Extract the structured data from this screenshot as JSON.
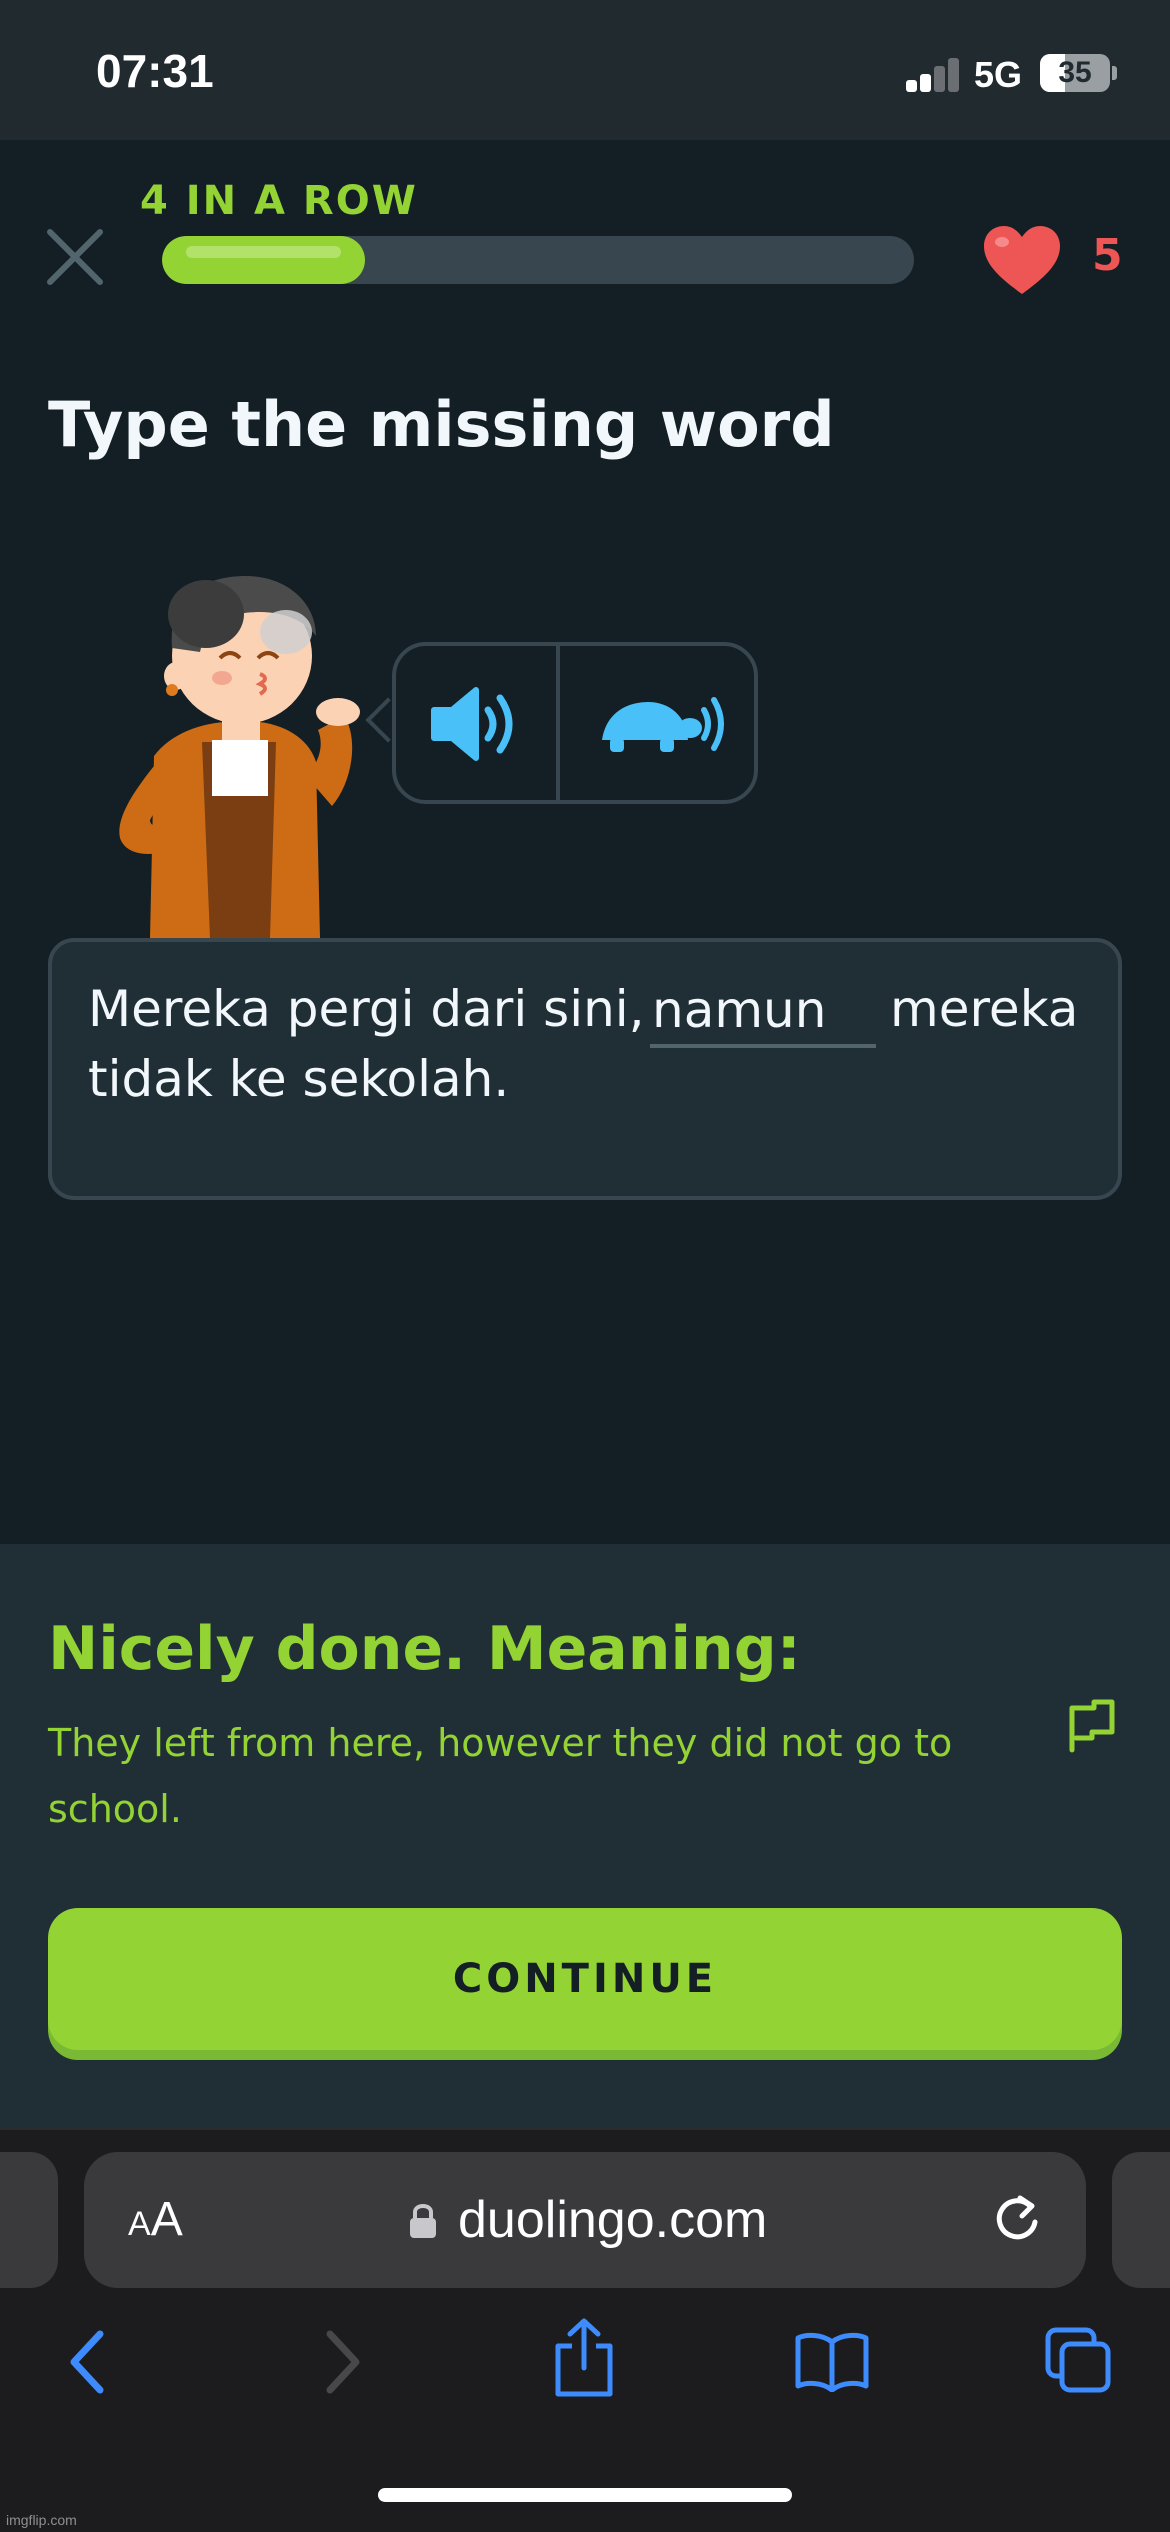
{
  "status_bar": {
    "time": "07:31",
    "network": "5G",
    "battery_level": "35",
    "battery_percent": 35,
    "signal_bars_active": 2,
    "signal_bars_total": 4
  },
  "header": {
    "streak_label": "4 IN A ROW",
    "progress_fraction": 0.27,
    "hearts_count": "5",
    "close_icon": "close-icon",
    "heart_icon": "heart-icon"
  },
  "challenge": {
    "title": "Type the missing word",
    "audio_normal_icon": "speaker-icon",
    "audio_slow_icon": "turtle-speaker-icon",
    "sentence_before": "Mereka pergi dari sini, ",
    "answer_value": "namun",
    "sentence_after": "mereka",
    "sentence_line2": "tidak ke sekolah."
  },
  "feedback": {
    "title": "Nicely done. Meaning:",
    "meaning": "They left from here, however they did not go to school.",
    "report_icon": "flag-icon",
    "continue_label": "CONTINUE"
  },
  "browser": {
    "text_size_label_small": "A",
    "text_size_label_large": "A",
    "url": "duolingo.com",
    "lock_icon": "lock-icon",
    "reload_icon": "reload-icon",
    "nav_icons": [
      "back-icon",
      "forward-icon",
      "share-icon",
      "bookmarks-icon",
      "tabs-icon"
    ]
  },
  "watermark": "imgflip.com",
  "colors": {
    "background": "#131f24",
    "accent_green": "#93d333",
    "heart_red": "#ee5555",
    "audio_blue": "#49c0f8",
    "panel": "#202f36",
    "border": "#37464f"
  }
}
